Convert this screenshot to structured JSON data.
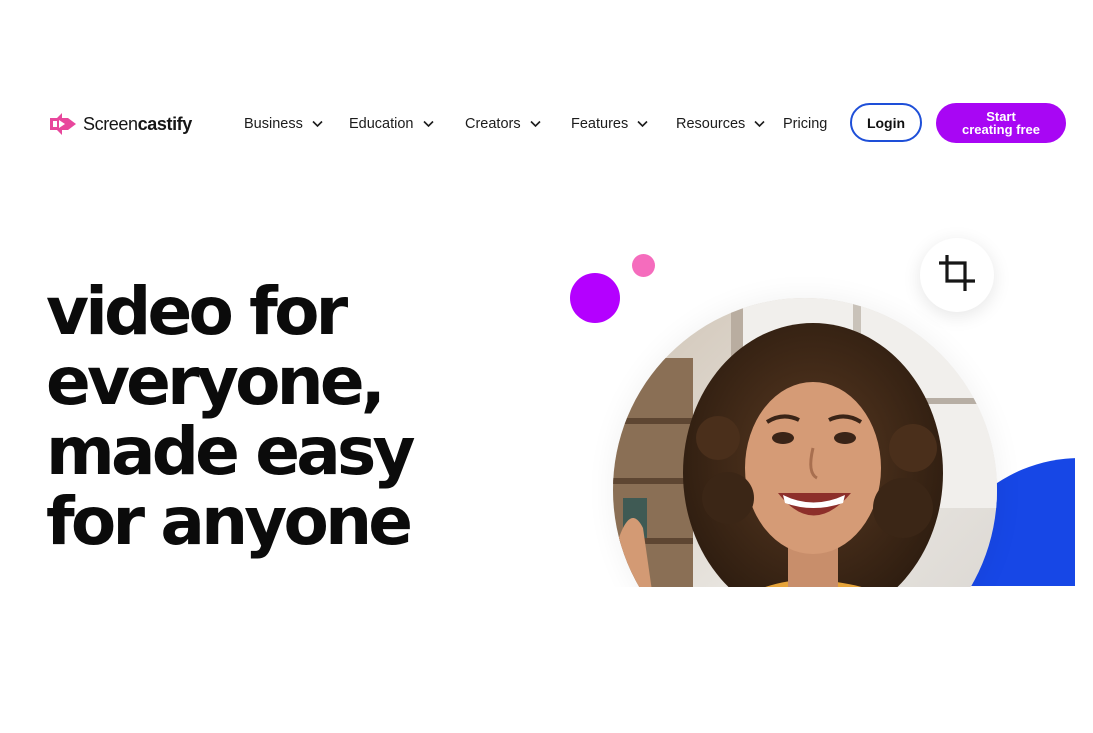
{
  "brand": {
    "name_part1": "Screen",
    "name_part2": "castify",
    "logo_icon": "screencastify-logo-icon",
    "logo_color": "#e8479c"
  },
  "nav": {
    "items": [
      {
        "label": "Business",
        "has_dropdown": true
      },
      {
        "label": "Education",
        "has_dropdown": true
      },
      {
        "label": "Creators",
        "has_dropdown": true
      },
      {
        "label": "Features",
        "has_dropdown": true
      },
      {
        "label": "Resources",
        "has_dropdown": true
      },
      {
        "label": "Pricing",
        "has_dropdown": false
      }
    ],
    "dropdown_icon": "chevron-down-icon"
  },
  "actions": {
    "login_label": "Login",
    "start_line1": "Start",
    "start_line2": "creating free"
  },
  "hero": {
    "lines": [
      "video for",
      "everyone,",
      "made easy",
      "for anyone"
    ],
    "crop_icon": "crop-icon",
    "photo": "smiling-woman-photo"
  },
  "colors": {
    "accent_purple": "#a806f4",
    "login_border": "#1e4fd8",
    "dot_purple": "#b400ff",
    "dot_pink": "#f56cbd",
    "blue_shape": "#1747e6"
  }
}
